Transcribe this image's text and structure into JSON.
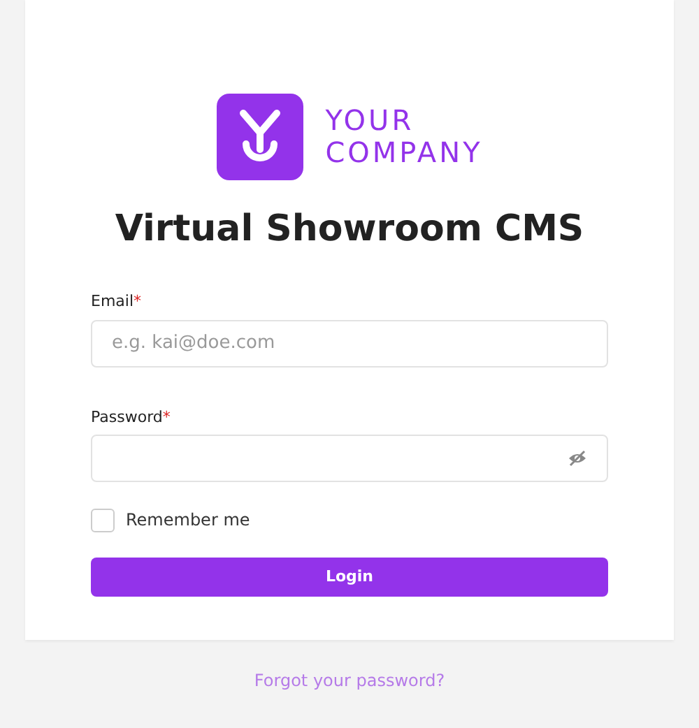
{
  "logo": {
    "line_1": "YOUR",
    "line_2": "COMPANY"
  },
  "title": "Virtual Showroom CMS",
  "fields": [
    {
      "kind": "email",
      "label": "Email",
      "required_mark": "*",
      "placeholder": "e.g. kai@doe.com"
    },
    {
      "kind": "password",
      "label": "Password",
      "required_mark": "*"
    }
  ],
  "remember": {
    "label": "Remember me",
    "checked": false
  },
  "login_button": "Login",
  "forgot_link": "Forgot your password?"
}
